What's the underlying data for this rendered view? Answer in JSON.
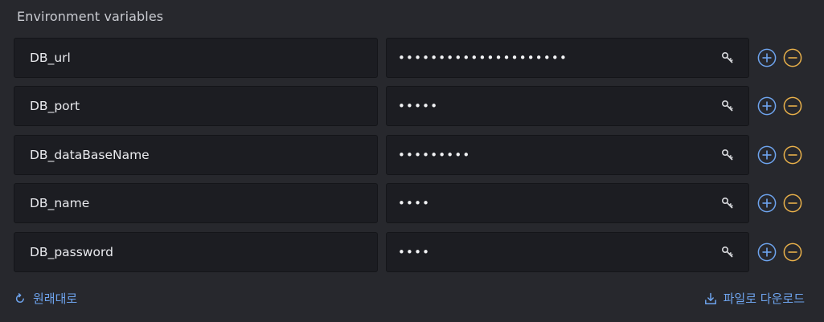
{
  "section": {
    "title": "Environment variables"
  },
  "env_rows": [
    {
      "key": "DB_url",
      "masked_value": "•••••••••••••••••••••"
    },
    {
      "key": "DB_port",
      "masked_value": "•••••"
    },
    {
      "key": "DB_dataBaseName",
      "masked_value": "•••••••••"
    },
    {
      "key": "DB_name",
      "masked_value": "••••"
    },
    {
      "key": "DB_password",
      "masked_value": "••••"
    }
  ],
  "icons": {
    "reveal": "key-icon",
    "add": "plus-circle-icon",
    "remove": "minus-circle-icon",
    "reset": "refresh-icon",
    "download": "download-icon"
  },
  "colors": {
    "background": "#27282d",
    "field": "#1c1d22",
    "add_accent": "#6ea4ee",
    "remove_accent": "#e8b04a",
    "link": "#6ea4ee"
  },
  "footer": {
    "reset_label": "원래대로",
    "download_label": "파일로 다운로드"
  }
}
